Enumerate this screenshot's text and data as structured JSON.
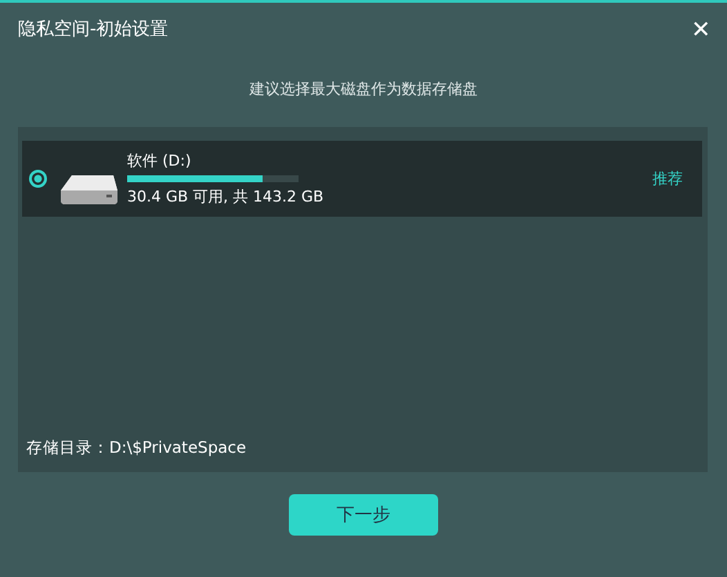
{
  "window": {
    "title": "隐私空间-初始设置",
    "close": "✕"
  },
  "hint": "建议选择最大磁盘作为数据存储盘",
  "drives": [
    {
      "name": "软件 (D:)",
      "level": 0.79,
      "info": "30.4 GB 可用, 共 143.2 GB",
      "badge": "推荐",
      "selected": true
    }
  ],
  "storage_path": "存储目录：D:\\$PrivateSpace",
  "buttons": [
    "下一步"
  ]
}
